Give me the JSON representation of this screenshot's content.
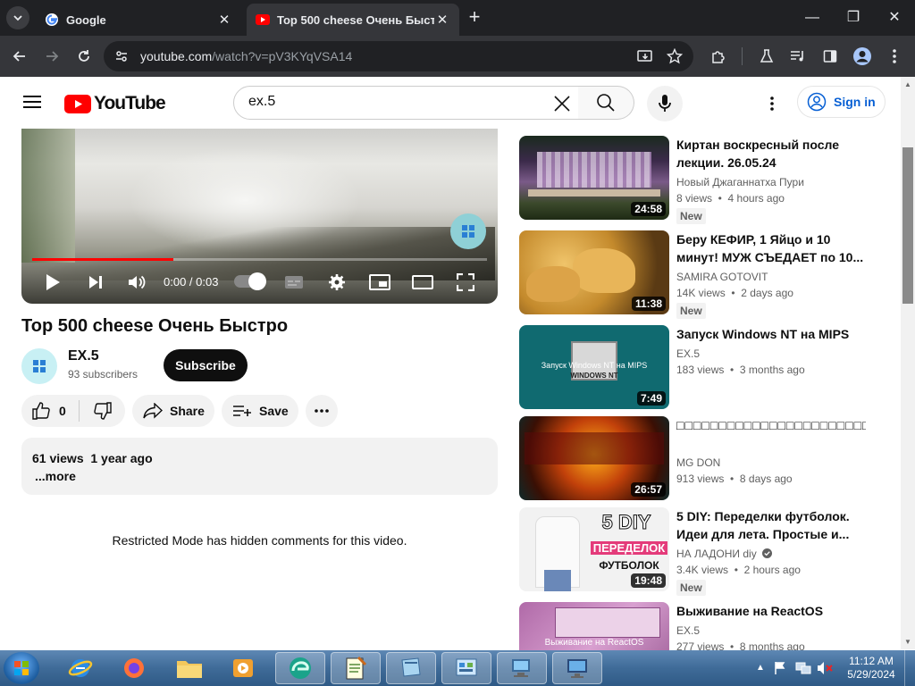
{
  "browser": {
    "tabs": [
      {
        "title": "Google",
        "active": false
      },
      {
        "title": "Top 500 cheese Очень Быстро",
        "active": true
      }
    ],
    "new_tab": "+",
    "window_controls": {
      "minimize": "—",
      "restore": "❐",
      "close": "✕"
    },
    "url_host": "youtube.com",
    "url_path": "/watch?v=pV3KYqVSA14"
  },
  "masthead": {
    "logo_text": "YouTube",
    "search_value": "ex.5",
    "signin_label": "Sign in"
  },
  "player": {
    "time_label": "0:00 / 0:03",
    "progress_fraction": 0.31
  },
  "video": {
    "title": "Top 500 cheese Очень Быстро",
    "channel": "EX.5",
    "subscribers": "93 subscribers",
    "subscribe_label": "Subscribe",
    "like_count": "0",
    "share_label": "Share",
    "save_label": "Save",
    "stats": "61 views  1 year ago",
    "more_label": "...more",
    "restricted_notice": "Restricted Mode has hidden comments for this video."
  },
  "related": [
    {
      "title": "Киртан воскресный после лекции. 26.05.24",
      "channel": "Новый Джаганнатха Пури",
      "meta": "8 views  •  4 hours ago",
      "duration": "24:58",
      "badge": "New",
      "verified": false
    },
    {
      "title": "Беру КЕФИР, 1 Яйцо и 10 минут! МУЖ СЪЕДАЕТ по 10...",
      "channel": "SAMIRA GOTOVIT",
      "meta": "14K views  •  2 days ago",
      "duration": "11:38",
      "badge": "New",
      "verified": false
    },
    {
      "title": "Запуск Windows NT на MIPS",
      "channel": "EX.5",
      "meta": "183 views  •  3 months ago",
      "duration": "7:49",
      "badge": "",
      "verified": false
    },
    {
      "title": "□□□□□□□□□□□□□□□□□□□□□□□□□□□□□□□□□□□...",
      "channel": "MG DON",
      "meta": "913 views  •  8 days ago",
      "duration": "26:57",
      "badge": "",
      "verified": false
    },
    {
      "title": "5 DIY: Переделки футболок. Идеи для лета. Простые и...",
      "channel": "НА ЛАДОНИ diy",
      "meta": "3.4K views  •  2 hours ago",
      "duration": "19:48",
      "badge": "New",
      "verified": true
    },
    {
      "title": "Выживание на ReactOS",
      "channel": "EX.5",
      "meta": "277 views  •  8 months ago",
      "duration": "",
      "badge": "",
      "verified": false
    }
  ],
  "thumb_text": {
    "mips": "Запуск Windows NT на MIPS",
    "mips_screen": "WINDOWS NT",
    "diy_line1": "5 DIY",
    "diy_line2": "ПЕРЕДЕЛОК",
    "diy_line3": "ФУТБОЛОК",
    "reactos": "Выживание на ReactOS"
  },
  "taskbar": {
    "time": "11:12 AM",
    "date": "5/29/2024"
  },
  "colors": {
    "youtube_red": "#ff0000",
    "link_blue": "#065fd4",
    "chrome_dark": "#202124"
  }
}
